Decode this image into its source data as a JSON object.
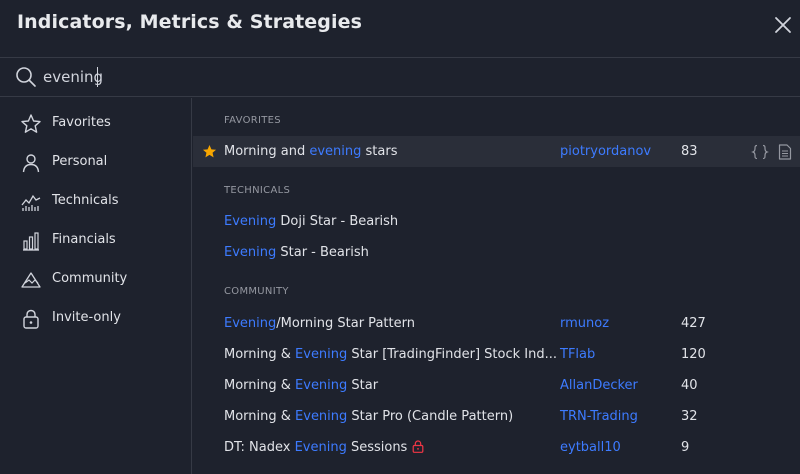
{
  "dialog": {
    "title": "Indicators, Metrics & Strategies"
  },
  "search": {
    "value": "evening",
    "placeholder": "Search"
  },
  "sidebar": {
    "items": [
      {
        "label": "Favorites",
        "icon": "star-outline-icon"
      },
      {
        "label": "Personal",
        "icon": "person-icon"
      },
      {
        "label": "Technicals",
        "icon": "technicals-chart-icon"
      },
      {
        "label": "Financials",
        "icon": "bar-chart-icon"
      },
      {
        "label": "Community",
        "icon": "community-icon"
      },
      {
        "label": "Invite-only",
        "icon": "lock-icon"
      }
    ]
  },
  "sections": {
    "favorites": {
      "header": "FAVORITES",
      "rows": [
        {
          "prefix": "Morning and ",
          "highlight": "evening",
          "suffix": " stars",
          "author": "piotryordanov",
          "count": "83"
        }
      ]
    },
    "technicals": {
      "header": "TECHNICALS",
      "rows": [
        {
          "prefix": "",
          "highlight": "Evening",
          "suffix": " Doji Star - Bearish"
        },
        {
          "prefix": "",
          "highlight": "Evening",
          "suffix": " Star - Bearish"
        }
      ]
    },
    "community": {
      "header": "COMMUNITY",
      "rows": [
        {
          "prefix": "",
          "highlight": "Evening",
          "suffix": "/Morning Star Pattern",
          "author": "rmunoz",
          "count": "427"
        },
        {
          "prefix": "Morning & ",
          "highlight": "Evening",
          "suffix": " Star [TradingFinder] Stock Ind...",
          "author": "TFlab",
          "count": "120"
        },
        {
          "prefix": "Morning & ",
          "highlight": "Evening",
          "suffix": " Star",
          "author": "AllanDecker",
          "count": "40"
        },
        {
          "prefix": "Morning & ",
          "highlight": "Evening",
          "suffix": " Star Pro (Candle Pattern)",
          "author": "TRN-Trading",
          "count": "32"
        },
        {
          "prefix": "DT: Nadex ",
          "highlight": "Evening",
          "suffix": " Sessions",
          "author": "eytball10",
          "count": "9",
          "locked": true
        }
      ]
    }
  },
  "colors": {
    "background": "#1e222d",
    "highlight": "#3d7bff",
    "favorite_star": "#f7a600",
    "lock": "#f23645",
    "selected_row": "#2a2e39"
  }
}
